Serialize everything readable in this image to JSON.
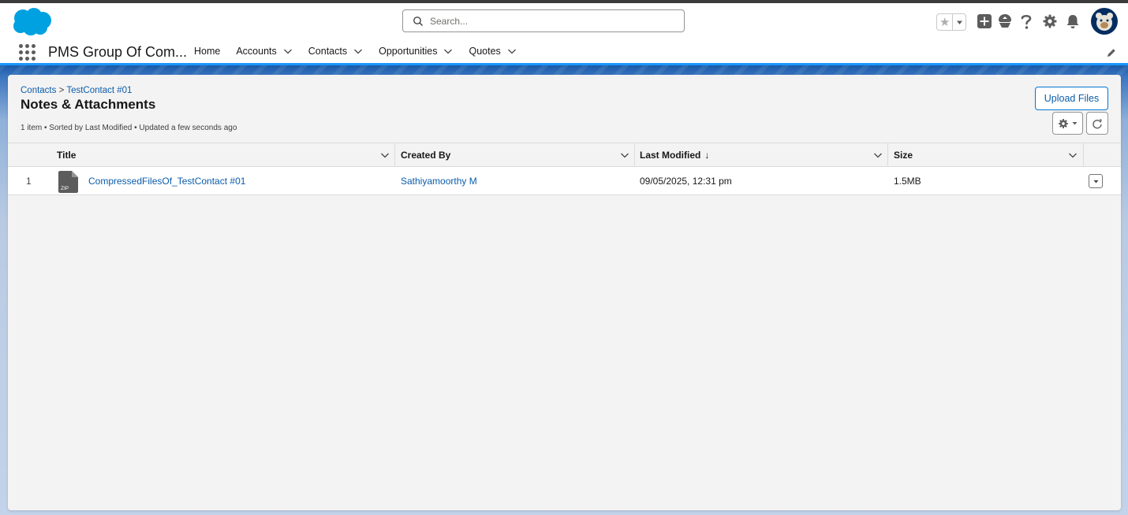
{
  "header": {
    "search_placeholder": "Search...",
    "icons": [
      "salesforce-cloud-logo",
      "favorites-star-icon",
      "global-create-icon",
      "trailhead-icon",
      "help-icon",
      "setup-gear-icon",
      "notifications-bell-icon",
      "user-avatar"
    ]
  },
  "nav": {
    "app_name": "PMS Group Of Com...",
    "items": [
      {
        "label": "Home",
        "has_menu": false
      },
      {
        "label": "Accounts",
        "has_menu": true
      },
      {
        "label": "Contacts",
        "has_menu": true
      },
      {
        "label": "Opportunities",
        "has_menu": true
      },
      {
        "label": "Quotes",
        "has_menu": true
      }
    ]
  },
  "page": {
    "breadcrumb_parent": "Contacts",
    "breadcrumb_separator": ">",
    "breadcrumb_record": "TestContact #01",
    "title": "Notes & Attachments",
    "info": "1 item • Sorted by Last Modified • Updated a few seconds ago",
    "upload_label": "Upload Files"
  },
  "table": {
    "columns": {
      "title": "Title",
      "created_by": "Created By",
      "last_modified": "Last Modified",
      "sort_arrow": "↓",
      "size": "Size"
    },
    "rows": [
      {
        "num": "1",
        "file_type": "ZIP",
        "title": "CompressedFilesOf_TestContact #01",
        "created_by": "Sathiyamoorthy M",
        "last_modified": "09/05/2025, 12:31 pm",
        "size": "1.5MB"
      }
    ]
  },
  "colors": {
    "brand_blue": "#0176d3",
    "link": "#0b5cab",
    "logo": "#00a1e0",
    "avatar": "#032d60"
  }
}
